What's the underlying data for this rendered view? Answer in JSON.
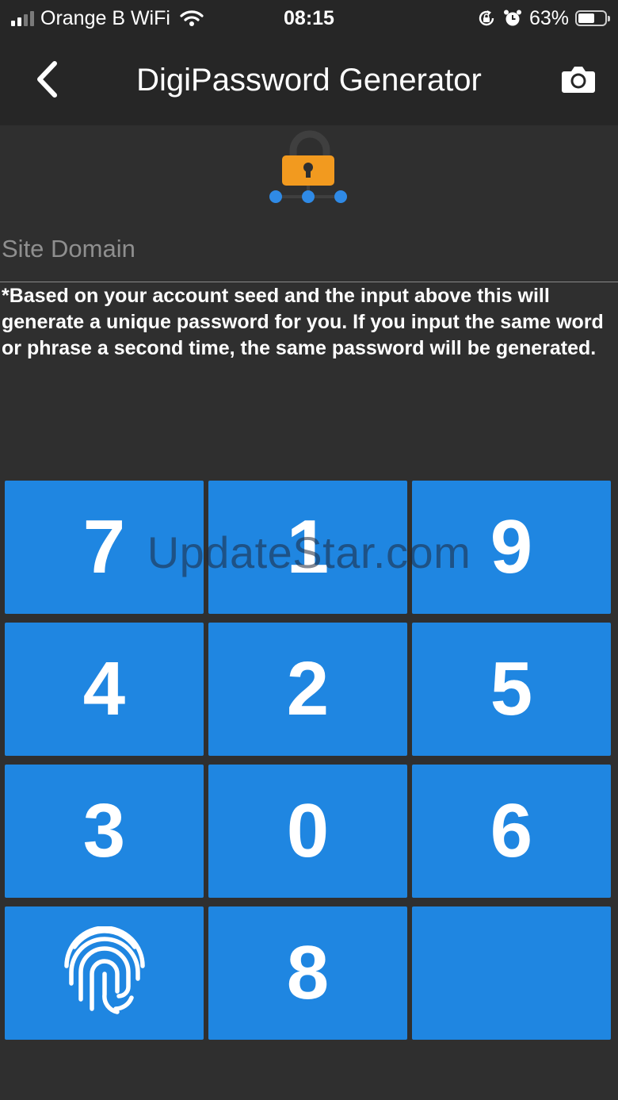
{
  "status_bar": {
    "carrier": "Orange B WiFi",
    "time": "08:15",
    "battery": "63%",
    "battery_level": 0.63
  },
  "nav": {
    "title": "DigiPassword Generator",
    "back_icon": "chevron-left-icon",
    "camera_icon": "camera-icon"
  },
  "input": {
    "placeholder": "Site Domain",
    "value": ""
  },
  "note": "*Based on your account seed and the input above this will generate a unique password for you.  If you input the same word or phrase a second time, the same password will be generated.",
  "keypad": {
    "keys": [
      "7",
      "1",
      "9",
      "4",
      "2",
      "5",
      "3",
      "0",
      "6",
      "",
      "8",
      ""
    ],
    "fingerprint_icon": "fingerprint-icon"
  },
  "watermark": "UpdateStar.com",
  "colors": {
    "background": "#2f2f2f",
    "bar": "#262626",
    "key_blue": "#1f86e1",
    "lock_orange": "#f29a1f",
    "dot_blue": "#2f8ae6"
  }
}
